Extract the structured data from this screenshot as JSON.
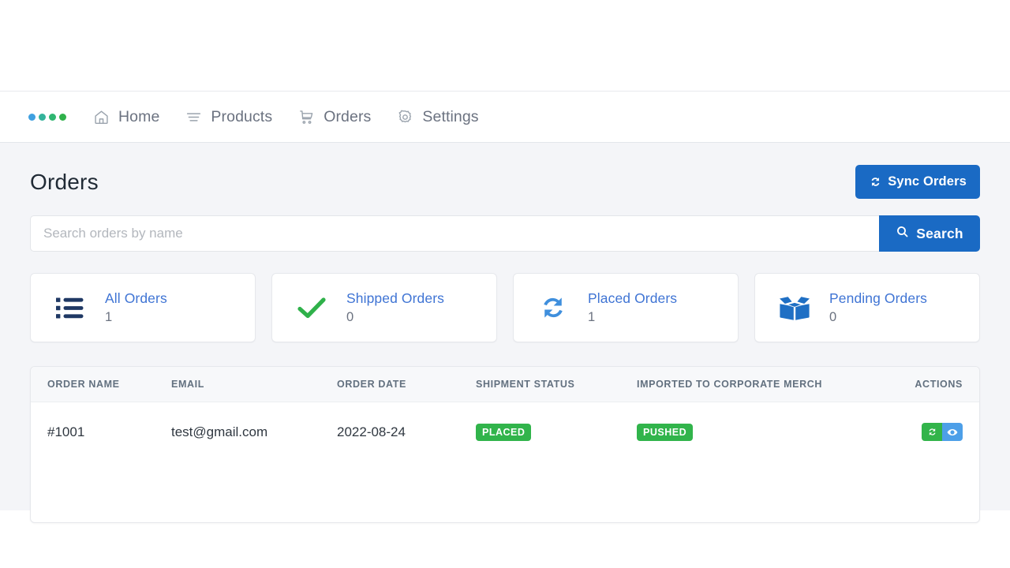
{
  "brand": {
    "logo_name": "four-dot-logo",
    "dot_colors": [
      "#3fa0e0",
      "#34b39b",
      "#2fb671",
      "#2fb14a"
    ]
  },
  "nav": {
    "items": [
      {
        "label": "Home",
        "icon": "home-icon"
      },
      {
        "label": "Products",
        "icon": "list-lines-icon"
      },
      {
        "label": "Orders",
        "icon": "shopping-cart-icon"
      },
      {
        "label": "Settings",
        "icon": "gear-icon"
      }
    ]
  },
  "header": {
    "title": "Orders",
    "sync_button": {
      "label": "Sync Orders",
      "icon": "sync-icon",
      "color": "#1a6ac4"
    }
  },
  "search": {
    "placeholder": "Search orders by name",
    "value": "",
    "button_label": "Search",
    "button_icon": "search-icon"
  },
  "stats": [
    {
      "label": "All Orders",
      "value": "1",
      "icon": "list-bullets-icon",
      "icon_color": "#1f3864"
    },
    {
      "label": "Shipped Orders",
      "value": "0",
      "icon": "check-icon",
      "icon_color": "#2fb14a"
    },
    {
      "label": "Placed Orders",
      "value": "1",
      "icon": "sync-icon",
      "icon_color": "#3f8fdd"
    },
    {
      "label": "Pending Orders",
      "value": "0",
      "icon": "open-box-icon",
      "icon_color": "#1f6fc4"
    }
  ],
  "table": {
    "columns": [
      "ORDER NAME",
      "EMAIL",
      "ORDER DATE",
      "SHIPMENT STATUS",
      "IMPORTED TO CORPORATE MERCH",
      "ACTIONS"
    ],
    "rows": [
      {
        "order_name": "#1001",
        "email": "test@gmail.com",
        "order_date": "2022-08-24",
        "shipment_status": "PLACED",
        "shipment_status_color": "#31b44b",
        "imported_status": "PUSHED",
        "imported_status_color": "#31b44b",
        "actions": [
          {
            "name": "resync-order-button",
            "icon": "sync-icon",
            "color": "#32b44a"
          },
          {
            "name": "view-order-button",
            "icon": "eye-icon",
            "color": "#4d9fe8"
          }
        ]
      }
    ]
  }
}
